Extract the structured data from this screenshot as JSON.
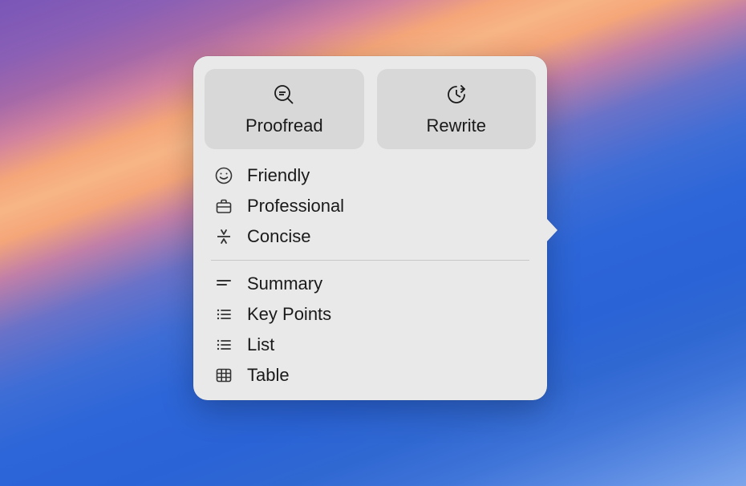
{
  "buttons": {
    "proofread": {
      "label": "Proofread"
    },
    "rewrite": {
      "label": "Rewrite"
    }
  },
  "toneSection": {
    "friendly": {
      "label": "Friendly"
    },
    "professional": {
      "label": "Professional"
    },
    "concise": {
      "label": "Concise"
    }
  },
  "formatSection": {
    "summary": {
      "label": "Summary"
    },
    "keypoints": {
      "label": "Key Points"
    },
    "list": {
      "label": "List"
    },
    "table": {
      "label": "Table"
    }
  }
}
